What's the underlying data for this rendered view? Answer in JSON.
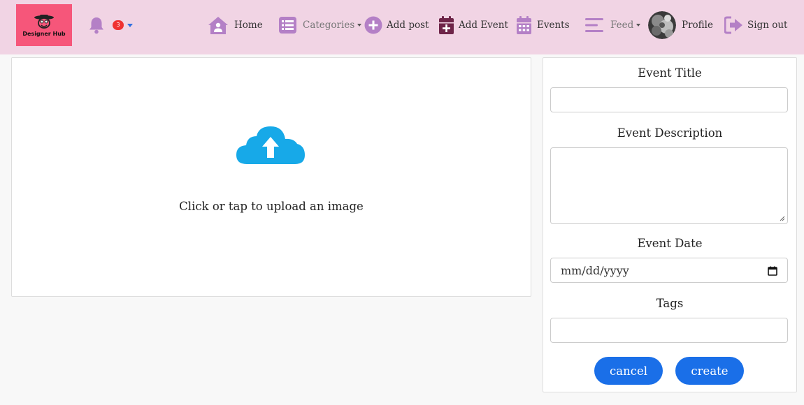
{
  "app": {
    "logo_text": "Designer Hub",
    "notification_count": "3"
  },
  "nav": {
    "home": "Home",
    "categories": "Categories",
    "add_post": "Add post",
    "add_event": "Add Event",
    "events": "Events",
    "feed": "Feed",
    "profile": "Profile",
    "sign_out": "Sign out"
  },
  "upload": {
    "prompt": "Click or tap to upload an image"
  },
  "form": {
    "title_label": "Event Title",
    "title_value": "",
    "description_label": "Event Description",
    "description_value": "",
    "date_label": "Event Date",
    "date_placeholder": "mm/dd/yyyy",
    "tags_label": "Tags",
    "tags_value": "",
    "cancel_label": "cancel",
    "create_label": "create"
  },
  "colors": {
    "navbar_bg": "#f1d4e4",
    "logo_bg": "#f6567a",
    "nav_icon_purple": "#b480c6",
    "add_event_icon": "#6e2448",
    "upload_cloud": "#17a9e8",
    "primary_button": "#1a6fe8",
    "badge": "#ef3131"
  },
  "icons": {
    "bell": "bell-icon",
    "home": "home-user-icon",
    "categories": "list-icon",
    "add_post": "plus-circle-icon",
    "add_event": "calendar-plus-icon",
    "events": "calendar-icon",
    "feed": "menu-lines-icon",
    "sign_out": "sign-out-icon",
    "upload": "cloud-upload-icon",
    "date": "calendar-small-icon"
  }
}
